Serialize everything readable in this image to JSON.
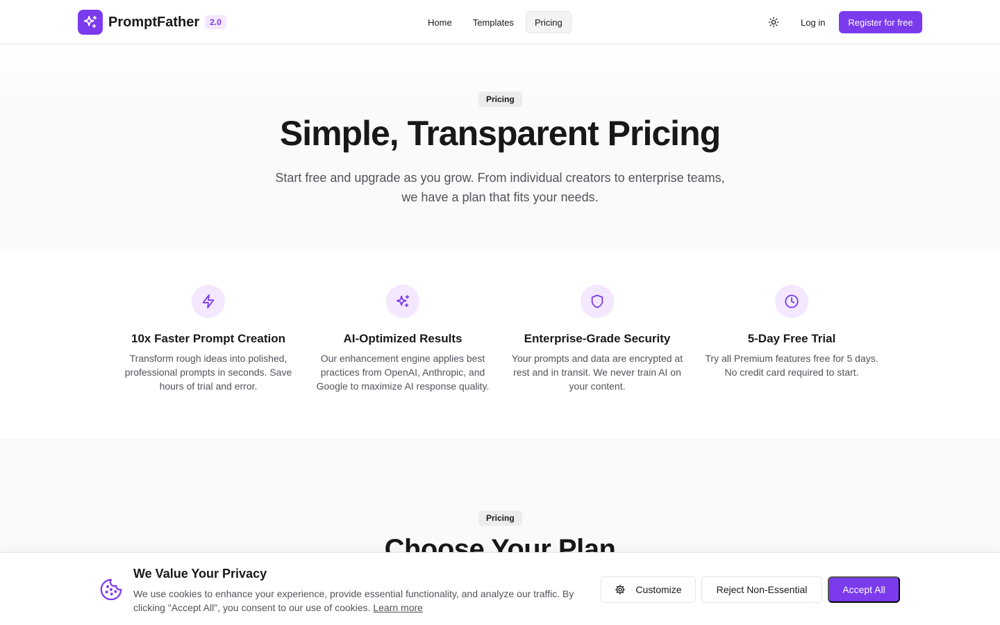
{
  "header": {
    "brand": "PromptFather",
    "version": "2.0",
    "nav": [
      {
        "label": "Home",
        "active": false
      },
      {
        "label": "Templates",
        "active": false
      },
      {
        "label": "Pricing",
        "active": true
      }
    ],
    "theme_toggle_icon": "sun-icon",
    "login_label": "Log in",
    "register_label": "Register for free"
  },
  "hero": {
    "badge": "Pricing",
    "title": "Simple, Transparent Pricing",
    "subtitle": "Start free and upgrade as you grow. From individual creators to enterprise teams, we have a plan that fits your needs."
  },
  "features": [
    {
      "icon": "zap-icon",
      "title": "10x Faster Prompt Creation",
      "description": "Transform rough ideas into polished, professional prompts in seconds. Save hours of trial and error."
    },
    {
      "icon": "sparkles-icon",
      "title": "AI-Optimized Results",
      "description": "Our enhancement engine applies best practices from OpenAI, Anthropic, and Google to maximize AI response quality."
    },
    {
      "icon": "shield-icon",
      "title": "Enterprise-Grade Security",
      "description": "Your prompts and data are encrypted at rest and in transit. We never train AI on your content."
    },
    {
      "icon": "clock-icon",
      "title": "5-Day Free Trial",
      "description": "Try all Premium features free for 5 days. No credit card required to start."
    }
  ],
  "plans": {
    "badge": "Pricing",
    "title": "Choose Your Plan"
  },
  "cookie_banner": {
    "icon": "cookie-icon",
    "title": "We Value Your Privacy",
    "text": "We use cookies to enhance your experience, provide essential functionality, and analyze our traffic. By clicking \"Accept All\", you consent to our use of cookies.",
    "link_label": "Learn more",
    "customize_label": "Customize",
    "reject_label": "Reject Non-Essential",
    "accept_label": "Accept All"
  },
  "colors": {
    "accent": "#7c3aed",
    "accent_soft": "#f3e8ff",
    "text": "#18181b",
    "muted": "#52525b",
    "border": "#e4e4e7"
  }
}
